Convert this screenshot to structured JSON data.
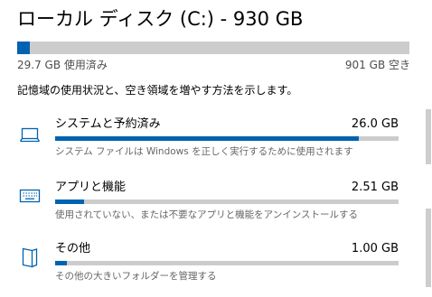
{
  "drive": {
    "title": "ローカル ディスク (C:) - 930 GB",
    "used_label": "29.7 GB 使用済み",
    "free_label": "901 GB 空き",
    "used_fraction": 0.032
  },
  "description": "記憶域の使用状況と、空き領域を増やす方法を示します。",
  "categories": [
    {
      "name": "システムと予約済み",
      "size": "26.0 GB",
      "fraction": 0.885,
      "description": "システム ファイルは Windows を正しく実行するために使用されます",
      "icon": "laptop-icon"
    },
    {
      "name": "アプリと機能",
      "size": "2.51 GB",
      "fraction": 0.085,
      "description": "使用されていない、または不要なアプリと機能をアンインストールする",
      "icon": "keyboard-icon"
    },
    {
      "name": "その他",
      "size": "1.00 GB",
      "fraction": 0.034,
      "description": "その他の大きいフォルダーを管理する",
      "icon": "document-icon"
    }
  ],
  "colors": {
    "accent": "#0063b1",
    "track": "#cccccc",
    "secondary_text": "#666666"
  }
}
